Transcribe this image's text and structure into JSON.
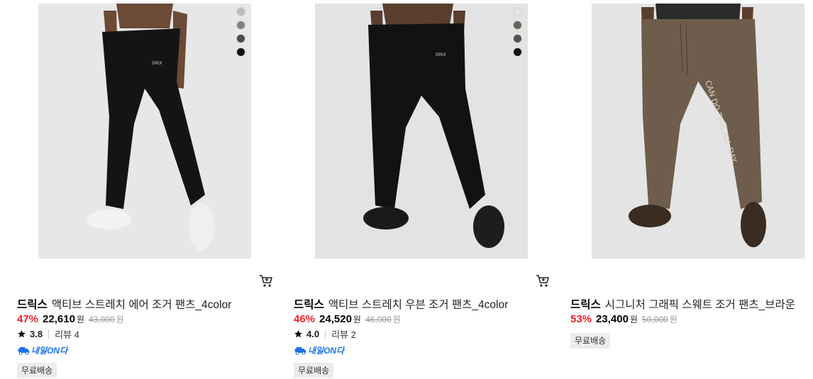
{
  "products": [
    {
      "brand": "드릭스",
      "name": "액티브 스트레치 에어 조거 팬츠_4color",
      "discount": "47%",
      "price": "22,610",
      "currency": "원",
      "original_price": "43,000",
      "rating": "3.8",
      "reviews": "리뷰 4",
      "badge": "내일ON다",
      "shipping": "무료배송",
      "swatches": [
        "#bdbdbd",
        "#7d857a",
        "#4a4a4a",
        "#111111"
      ]
    },
    {
      "brand": "드릭스",
      "name": "액티브 스트레치 우븐 조거 팬츠_4color",
      "discount": "46%",
      "price": "24,520",
      "currency": "원",
      "original_price": "46,000",
      "rating": "4.0",
      "reviews": "리뷰 2",
      "badge": "내일ON다",
      "shipping": "무료배송",
      "swatches": [
        "#e6e6e6",
        "#5e6858",
        "#4f5458",
        "#111111"
      ]
    },
    {
      "brand": "드릭스",
      "name": "시그니처 그래픽 스웨트 조거 팬츠_브라운",
      "discount": "53%",
      "price": "23,400",
      "currency": "원",
      "original_price": "50,000",
      "shipping": "무료배송"
    }
  ],
  "graphic_text": "CAN DO THIS ALL DAY",
  "colors": {
    "discount": "#f01e28",
    "naeil_blue": "#1a73e8"
  }
}
